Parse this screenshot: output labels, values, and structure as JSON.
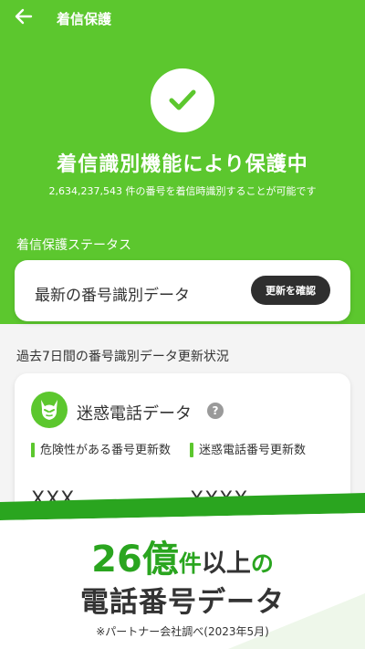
{
  "header": {
    "title": "着信保護"
  },
  "hero": {
    "title": "着信識別機能により保護中",
    "count": "2,634,237,543",
    "count_suffix": " 件の番号を着信時識別することが可能です"
  },
  "status_section": {
    "label": "着信保護ステータス",
    "card_text": "最新の番号識別データ",
    "button_label": "更新を確認"
  },
  "history_section": {
    "label": "過去7日間の番号識別データ更新状況"
  },
  "data_card": {
    "title": "迷惑電話データ",
    "help": "?",
    "stats": [
      {
        "label": "危険性がある番号更新数",
        "value": "XXX"
      },
      {
        "label": "迷惑電話番号更新数",
        "value": "XXXX"
      }
    ]
  },
  "banner": {
    "number": "26億",
    "unit": "件",
    "suffix": "以上",
    "particle": "の",
    "line2": "電話番号データ",
    "note": "※パートナー会社調べ(2023年5月)"
  },
  "colors": {
    "brand_green": "#5cc72e",
    "banner_green": "#2aa51f",
    "button_dark": "#2f2f2f"
  }
}
